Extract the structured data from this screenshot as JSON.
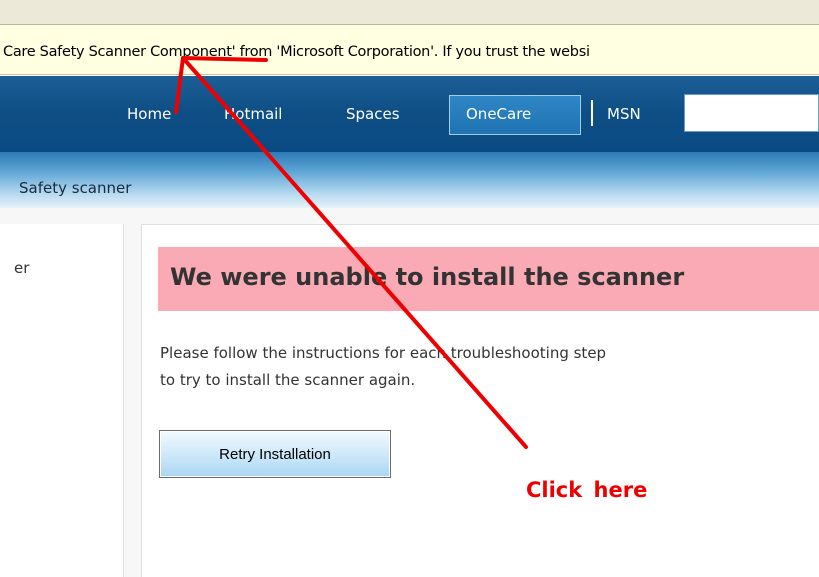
{
  "info_bar": {
    "message": "Care Safety Scanner Component' from 'Microsoft Corporation'. If you trust the websi"
  },
  "nav": {
    "items": [
      {
        "label": "Home"
      },
      {
        "label": "Hotmail"
      },
      {
        "label": "Spaces"
      },
      {
        "label": "OneCare",
        "active": true
      },
      {
        "label": "MSN"
      }
    ],
    "search_value": ""
  },
  "breadcrumb": "Safety scanner",
  "left_panel": {
    "label": "er"
  },
  "main": {
    "heading": "We were unable to install the scanner",
    "instructions_line1": "Please follow the instructions for each troubleshooting step",
    "instructions_line2": "to try to install the scanner again.",
    "retry_button_label": "Retry Installation"
  },
  "annotation": {
    "text": "Click here",
    "color": "#ee0000"
  },
  "colors": {
    "nav_dark": "#0f4f86",
    "active_tab": "#2f86c5",
    "heading_bg": "#f9aab5",
    "info_bar_bg": "#ffffe1"
  }
}
